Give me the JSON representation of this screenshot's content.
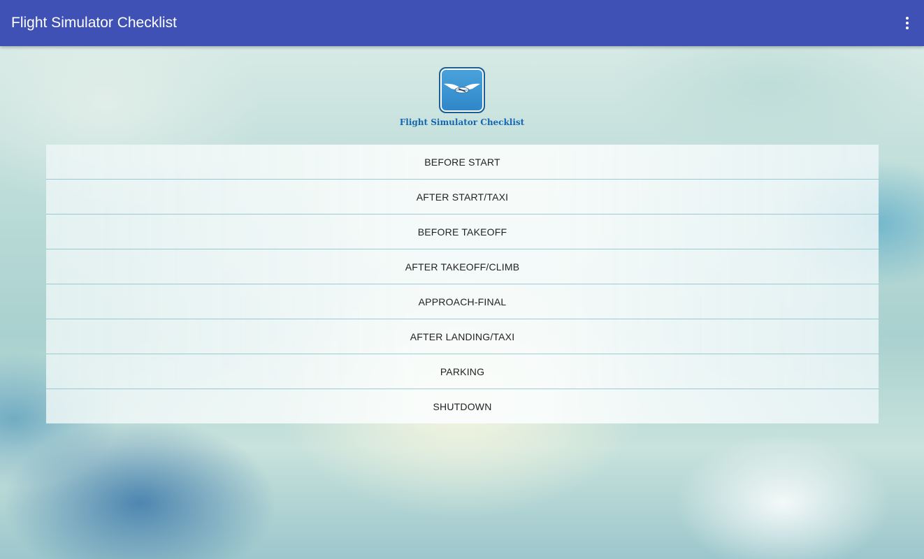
{
  "app_bar": {
    "title": "Flight Simulator Checklist",
    "overflow_icon": "more-vert-icon",
    "background_color": "#3f51b5"
  },
  "logo": {
    "icon": "winged-airplane-logo-icon",
    "text": "Flight Simulator Checklist",
    "text_color": "#1566b0"
  },
  "checklist": {
    "items": [
      {
        "label": "BEFORE START"
      },
      {
        "label": "AFTER START/TAXI"
      },
      {
        "label": "BEFORE TAKEOFF"
      },
      {
        "label": "AFTER TAKEOFF/CLIMB"
      },
      {
        "label": "APPROACH-FINAL"
      },
      {
        "label": "AFTER LANDING/TAXI"
      },
      {
        "label": "PARKING"
      },
      {
        "label": "SHUTDOWN"
      }
    ]
  }
}
